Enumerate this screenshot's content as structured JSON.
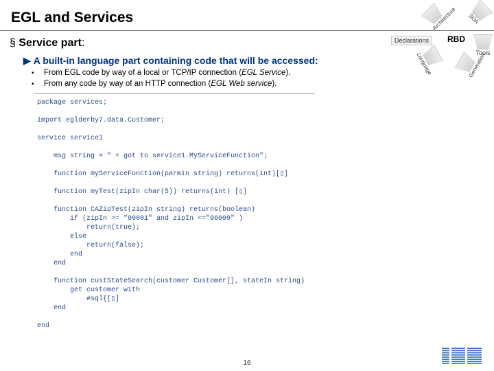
{
  "title": "EGL and Services",
  "subhead_prefix": "§ ",
  "subhead_bold": "Service part",
  "subhead_colon": ":",
  "bullet_arrow": "▶",
  "bullet_text": "A built-in language part containing code that will be accessed:",
  "sub1_prefix": "From EGL code by way of a local or TCP/IP connection (",
  "sub1_em": "EGL Service",
  "sub1_suffix": ").",
  "sub2_prefix": "From any code by way of an HTTP connection (",
  "sub2_em": "EGL Web service",
  "sub2_suffix": ").",
  "code": "package services;\n\nimport eglderby7.data.Customer;\n\nservice service1\n\n    msg string = \" + got to service1.MyServiceFunction\";\n\n    function myServiceFunction(parmin string) returns(int)[▯]\n\n    function myTest(zipIn char(5)) returns(int) [▯]\n\n    function CAZipTest(zipIn string) returns(boolean)\n        if (zipIn >= \"90001\" and zipIn <=\"96009\" )\n            return(true);\n        else\n            return(false);\n        end\n    end\n\n    function custStateSearch(customer Customer[], stateIn string)\n        get customer with\n            #sql{[▯]\n    end\n\nend",
  "wedges": {
    "top_left": "Architecture",
    "top_right": "SOA",
    "right": "Tools",
    "left": "Language",
    "bottom": "Generation",
    "decl": "Declarations",
    "center": "RBD"
  },
  "slide_number": "16",
  "logo_alt": "IBM"
}
